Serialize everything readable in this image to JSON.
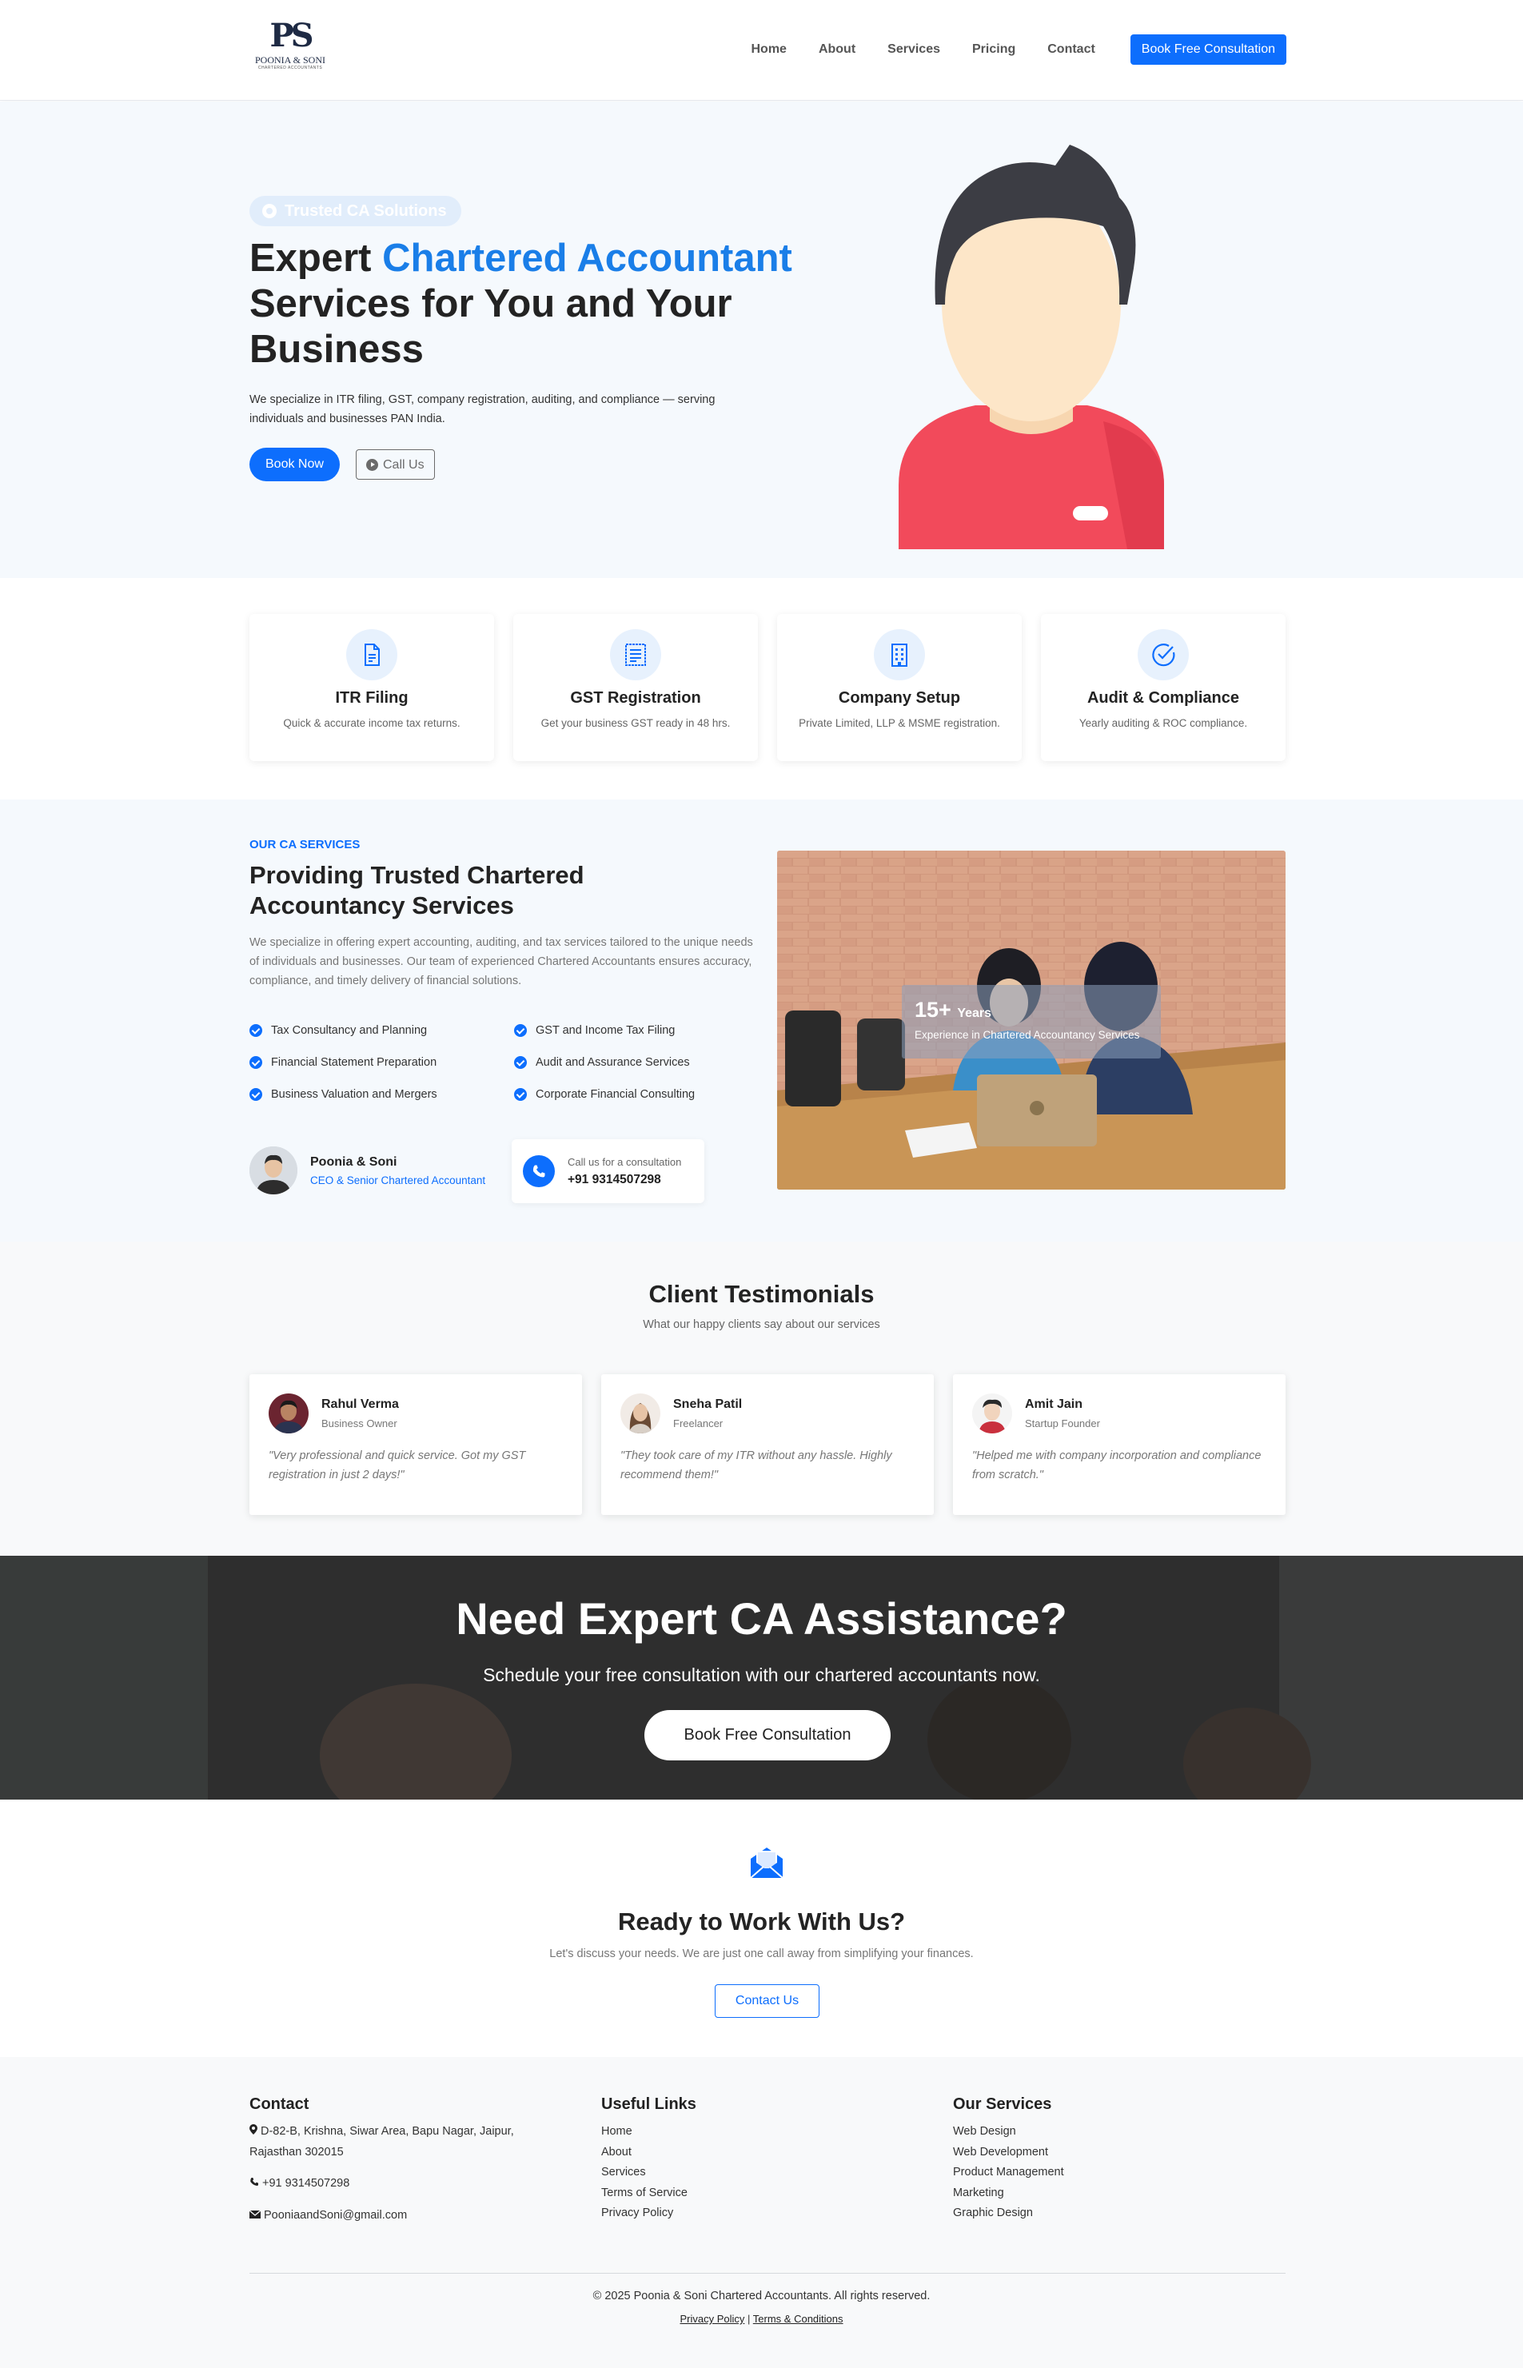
{
  "brand": {
    "logo_mark": "PS",
    "logo_name": "POONIA & SONI",
    "logo_sub": "CHARTERED ACCOUNTANTS"
  },
  "nav": {
    "links": [
      "Home",
      "About",
      "Services",
      "Pricing",
      "Contact"
    ],
    "cta": "Book Free Consultation"
  },
  "hero": {
    "badge": "Trusted CA Solutions",
    "title_part1": "Expert ",
    "title_hl": "Chartered Accountant",
    "title_part2": " Services for You and Your Business",
    "description": "We specialize in ITR filing, GST, company registration, auditing, and compliance — serving individuals and businesses PAN India.",
    "btn_book": "Book Now",
    "btn_call": "Call Us"
  },
  "features": [
    {
      "title": "ITR Filing",
      "desc": "Quick & accurate income tax returns.",
      "icon": "document-icon"
    },
    {
      "title": "GST Registration",
      "desc": "Get your business GST ready in 48 hrs.",
      "icon": "receipt-icon"
    },
    {
      "title": "Company Setup",
      "desc": "Private Limited, LLP & MSME registration.",
      "icon": "building-icon"
    },
    {
      "title": "Audit & Compliance",
      "desc": "Yearly auditing & ROC compliance.",
      "icon": "check-circle-icon"
    }
  ],
  "services": {
    "tag": "OUR CA SERVICES",
    "title": "Providing Trusted Chartered Accountancy Services",
    "description": "We specialize in offering expert accounting, auditing, and tax services tailored to the unique needs of individuals and businesses. Our team of experienced Chartered Accountants ensures accuracy, compliance, and timely delivery of financial solutions.",
    "items": [
      "Tax Consultancy and Planning",
      "GST and Income Tax Filing",
      "Financial Statement Preparation",
      "Audit and Assurance Services",
      "Business Valuation and Mergers",
      "Corporate Financial Consulting"
    ],
    "ceo_name": "Poonia & Soni",
    "ceo_role": "CEO & Senior Chartered Accountant",
    "call_label": "Call us for a consultation",
    "call_number": "+91 9314507298",
    "exp_num": "15+",
    "exp_unit": "Years",
    "exp_label": "Experience in Chartered Accountancy Services"
  },
  "testimonials": {
    "title": "Client Testimonials",
    "subtitle": "What our happy clients say about our services",
    "items": [
      {
        "name": "Rahul Verma",
        "role": "Business Owner",
        "quote": "\"Very professional and quick service. Got my GST registration in just 2 days!\""
      },
      {
        "name": "Sneha Patil",
        "role": "Freelancer",
        "quote": "\"They took care of my ITR without any hassle. Highly recommend them!\""
      },
      {
        "name": "Amit Jain",
        "role": "Startup Founder",
        "quote": "\"Helped me with company incorporation and compliance from scratch.\""
      }
    ]
  },
  "cta": {
    "title": "Need Expert CA Assistance?",
    "subtitle": "Schedule your free consultation with our chartered accountants now.",
    "button": "Book Free Consultation"
  },
  "ready": {
    "title": "Ready to Work With Us?",
    "subtitle": "Let's discuss your needs. We are just one call away from simplifying your finances.",
    "button": "Contact Us"
  },
  "footer": {
    "contact_title": "Contact",
    "address": "D-82-B, Krishna, Siwar Area, Bapu Nagar, Jaipur, Rajasthan 302015",
    "phone": "+91 9314507298",
    "email": "PooniaandSoni@gmail.com",
    "links_title": "Useful Links",
    "links": [
      "Home",
      "About",
      "Services",
      "Terms of Service",
      "Privacy Policy"
    ],
    "services_title": "Our Services",
    "services": [
      "Web Design",
      "Web Development",
      "Product Management",
      "Marketing",
      "Graphic Design"
    ],
    "copyright": "© 2025 Poonia & Soni Chartered Accountants. All rights reserved.",
    "privacy": "Privacy Policy",
    "separator": "|",
    "terms": "Terms & Conditions"
  }
}
